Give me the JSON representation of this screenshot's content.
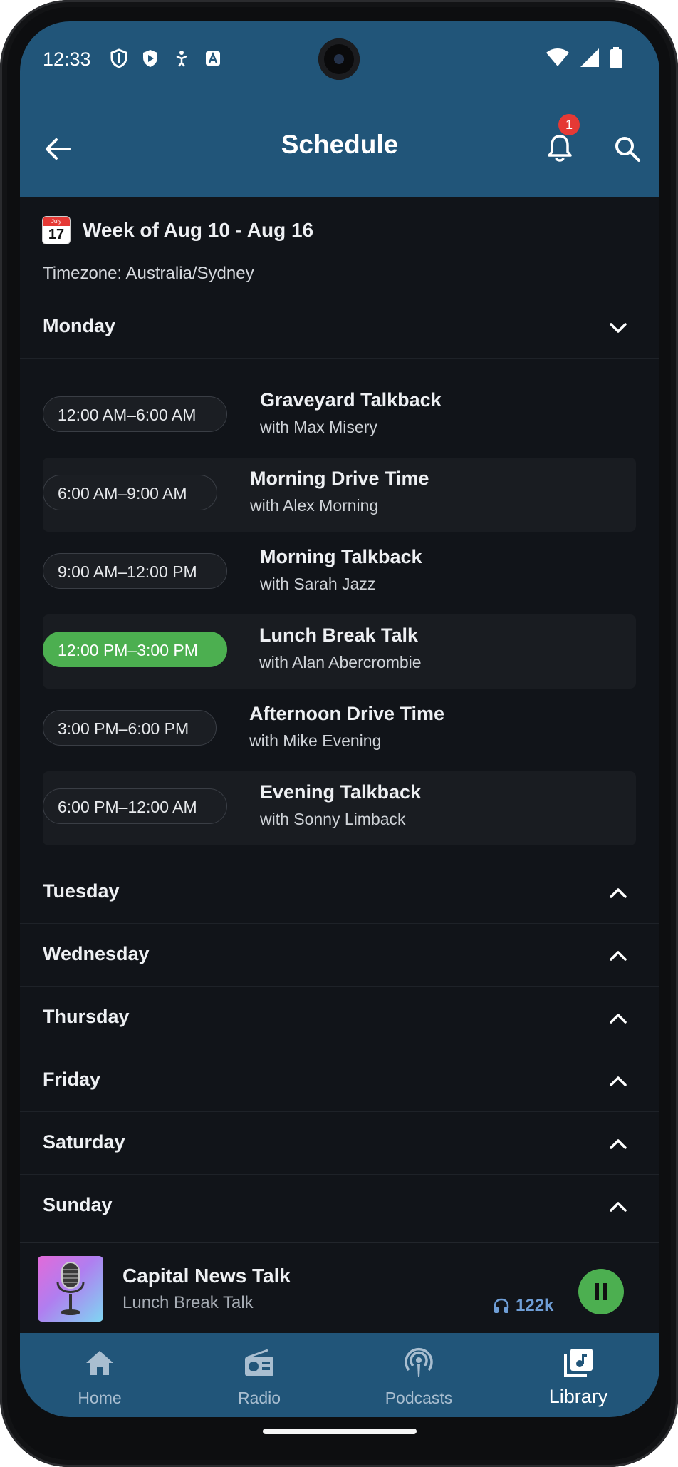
{
  "status_bar": {
    "time": "12:33",
    "icons_left": [
      "shield-outline-icon",
      "shield-play-icon",
      "accessibility-icon",
      "a-box-icon"
    ],
    "icons_right": [
      "wifi-icon",
      "cellular-signal-icon",
      "battery-icon"
    ]
  },
  "app_bar": {
    "title": "Schedule",
    "notification_count": "1",
    "colors": {
      "bar": "#215579",
      "badge": "#e53935"
    }
  },
  "schedule": {
    "week_label": "Week of Aug 10 - Aug 16",
    "calendar_icon": {
      "month": "July",
      "day": "17"
    },
    "timezone": "Timezone: Australia/Sydney",
    "expanded_day": "Monday",
    "shows": [
      {
        "time": "12:00 AM–6:00 AM",
        "title": "Graveyard Talkback",
        "host": "with Max Misery",
        "live": false
      },
      {
        "time": "6:00 AM–9:00 AM",
        "title": "Morning Drive Time",
        "host": "with Alex Morning",
        "live": false
      },
      {
        "time": "9:00 AM–12:00 PM",
        "title": "Morning Talkback",
        "host": "with Sarah Jazz",
        "live": false
      },
      {
        "time": "12:00 PM–3:00 PM",
        "title": "Lunch Break Talk",
        "host": "with Alan Abercrombie",
        "live": true
      },
      {
        "time": "3:00 PM–6:00 PM",
        "title": "Afternoon Drive Time",
        "host": "with Mike Evening",
        "live": false
      },
      {
        "time": "6:00 PM–12:00 AM",
        "title": "Evening Talkback",
        "host": "with Sonny Limback",
        "live": false
      }
    ],
    "collapsed_days": [
      "Tuesday",
      "Wednesday",
      "Thursday",
      "Friday",
      "Saturday",
      "Sunday"
    ],
    "live_color": "#4caf50"
  },
  "player": {
    "station": "Capital News Talk",
    "show": "Lunch Break Talk",
    "listeners": "122k",
    "art_icon": "microphone-icon"
  },
  "bottom_nav": {
    "items": [
      {
        "label": "Home",
        "icon": "home-icon",
        "active": false
      },
      {
        "label": "Radio",
        "icon": "radio-icon",
        "active": false
      },
      {
        "label": "Podcasts",
        "icon": "podcast-icon",
        "active": false
      },
      {
        "label": "Library",
        "icon": "library-music-icon",
        "active": true
      }
    ]
  }
}
